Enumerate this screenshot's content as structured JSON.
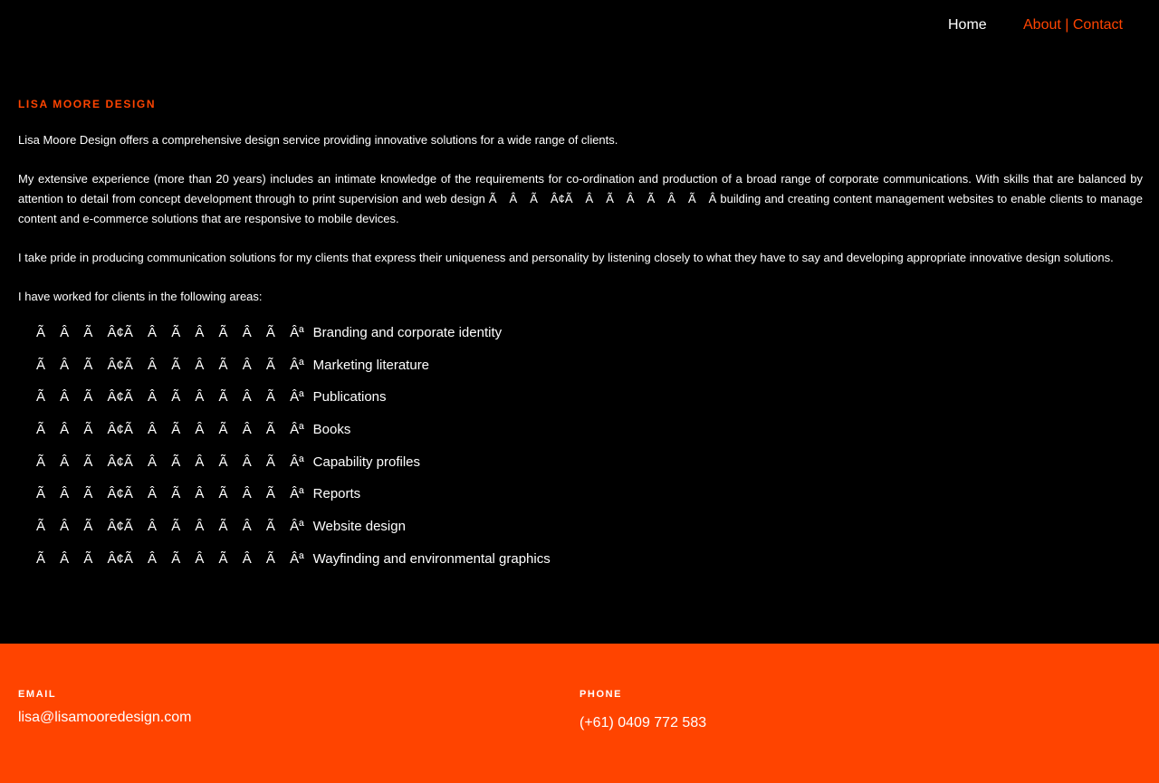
{
  "nav": {
    "home": "Home",
    "about_contact": "About | Contact"
  },
  "content": {
    "heading": "LISA MOORE DESIGN",
    "intro": "Lisa Moore Design offers a comprehensive design service providing innovative solutions for a wide range of clients.",
    "experience_part1": "My extensive experience (more than 20 years) includes an intimate knowledge of the requirements for co-ordination and production of a broad range of corporate communications. With skills that are balanced by attention to detail from concept development through to print supervision and web design",
    "experience_garble": "Ã Â Ã Â¢Ã Â Ã Â Ã Â Ã Â",
    "experience_part2": "building and creating content management websites to enable clients to manage content and e-commerce solutions that are responsive to mobile devices.",
    "pride": "I take pride in producing communication solutions for my clients that express their uniqueness and personality by listening closely to what they have to say and developing appropriate innovative design solutions.",
    "areas_intro": "I have worked for clients in the following areas:",
    "bullet_garble": "Ã Â Ã Â¢Ã Â Ã Â Ã Â Ã Âª",
    "areas": [
      "Branding and corporate identity",
      "Marketing literature",
      "Publications",
      "Books",
      "Capability profiles",
      "Reports",
      "Website design",
      "Wayfinding and environmental graphics"
    ]
  },
  "footer": {
    "email_label": "EMAIL",
    "email": "lisa@lisamooredesign.com",
    "phone_label": "PHONE",
    "phone": "(+61) 0409 772 583"
  },
  "colors": {
    "accent": "#ff4400",
    "background": "#000000",
    "text": "#ffffff"
  }
}
